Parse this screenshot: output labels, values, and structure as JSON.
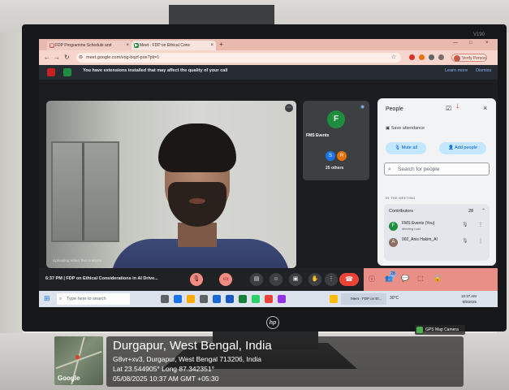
{
  "browser": {
    "tab1_label": "FDP Programme Schedule and",
    "tab2_label": "Meet - FDP on Ethical Cons",
    "url": "meet.google.com/vog-bqzf-pxe?pli=1",
    "profile_label": "Verify Person"
  },
  "banner": {
    "message": "You have extensions installed that may affect the quality of your call",
    "learn_more": "Learn more",
    "dismiss": "Dismiss"
  },
  "video": {
    "tile_initial": "F",
    "tile_name": "FMS Events",
    "others_label": "25 others",
    "others_avatars": [
      "S",
      "R"
    ],
    "watermark": "Uploading Video Text Analysis"
  },
  "people_panel": {
    "title": "People",
    "save_attendance": "Save attendance",
    "mute_all": "Mute all",
    "add_people": "Add people",
    "search_placeholder": "Search for people",
    "in_meeting_label": "IN THE MEETING",
    "contributors_label": "Contributors",
    "contributors_count": "28",
    "participants": [
      {
        "initial": "F",
        "name": "FMS Events (You)",
        "sub": "Meeting host",
        "color": "#1e8e3e"
      },
      {
        "initial": "A",
        "name": "002_Anis Hakim_AI",
        "sub": "",
        "color": "#8d6e63"
      }
    ]
  },
  "controls": {
    "meeting_info": "6:37 PM | FDP on Ethical Considerations in AI Drive...",
    "participant_badge": "28"
  },
  "taskbar": {
    "search_placeholder": "Type here to search",
    "meet_window": "Meet - FDP on Et...",
    "weather": "30°C",
    "time": "10:37 AM",
    "date": "8/5/2025"
  },
  "gps_overlay": {
    "city": "Durgapur, West Bengal, India",
    "address": "G8vr+xv3, Durgapur, West Bengal 713206, India",
    "coords": "Lat 23.544905° Long 87.342351°",
    "datetime": "05/08/2025 10:37 AM GMT +05:30",
    "badge": "GPS Map Camera",
    "map_brand": "Google"
  },
  "monitor": {
    "brand": "hp",
    "model": "V190"
  }
}
